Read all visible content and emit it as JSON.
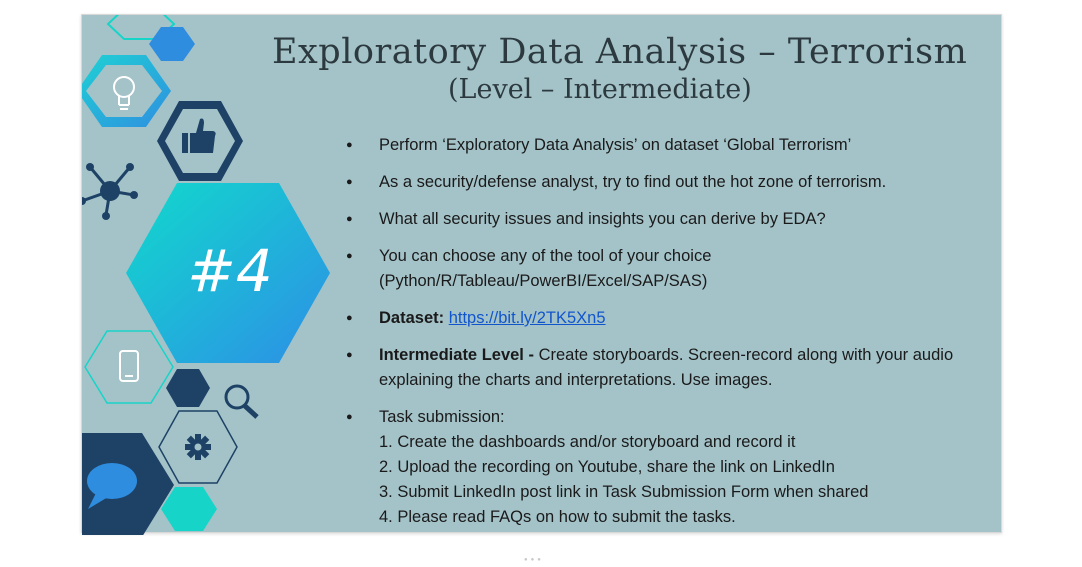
{
  "slide": {
    "title": "Exploratory Data Analysis – Terrorism",
    "subtitle": "(Level – Intermediate)",
    "badge": "#4",
    "bullets": {
      "b1": "Perform ‘Exploratory Data Analysis’ on dataset  ‘Global Terrorism’",
      "b2": "As a security/defense analyst, try to find out the hot zone of terrorism.",
      "b3": "What all security issues and insights you can derive by EDA?",
      "b4_line1": "You can choose any of the tool of your choice",
      "b4_line2": "(Python/R/Tableau/PowerBI/Excel/SAP/SAS)",
      "dataset_label": "Dataset:",
      "dataset_link": "https://bit.ly/2TK5Xn5",
      "level_label": "Intermediate Level -",
      "level_text": " Create storyboards. Screen-record along with your audio explaining the charts and interpretations. Use images.",
      "task_heading": "Task submission:",
      "tasks": [
        "1. Create the dashboards and/or storyboard and record it",
        "2. Upload the recording on Youtube, share the link on LinkedIn",
        "3. Submit LinkedIn post link in Task Submission Form when shared",
        "4. Please read FAQs on how to submit the tasks."
      ]
    }
  },
  "colors": {
    "slide_bg": "#a4c3c9",
    "navy": "#1d4266",
    "teal": "#17d4c8",
    "blue": "#2f8de0",
    "link": "#1155cc"
  },
  "icons": [
    "lightbulb-icon",
    "thumbs-up-icon",
    "network-icon",
    "phone-icon",
    "magnifier-icon",
    "gear-icon",
    "chat-bubble-icon"
  ]
}
